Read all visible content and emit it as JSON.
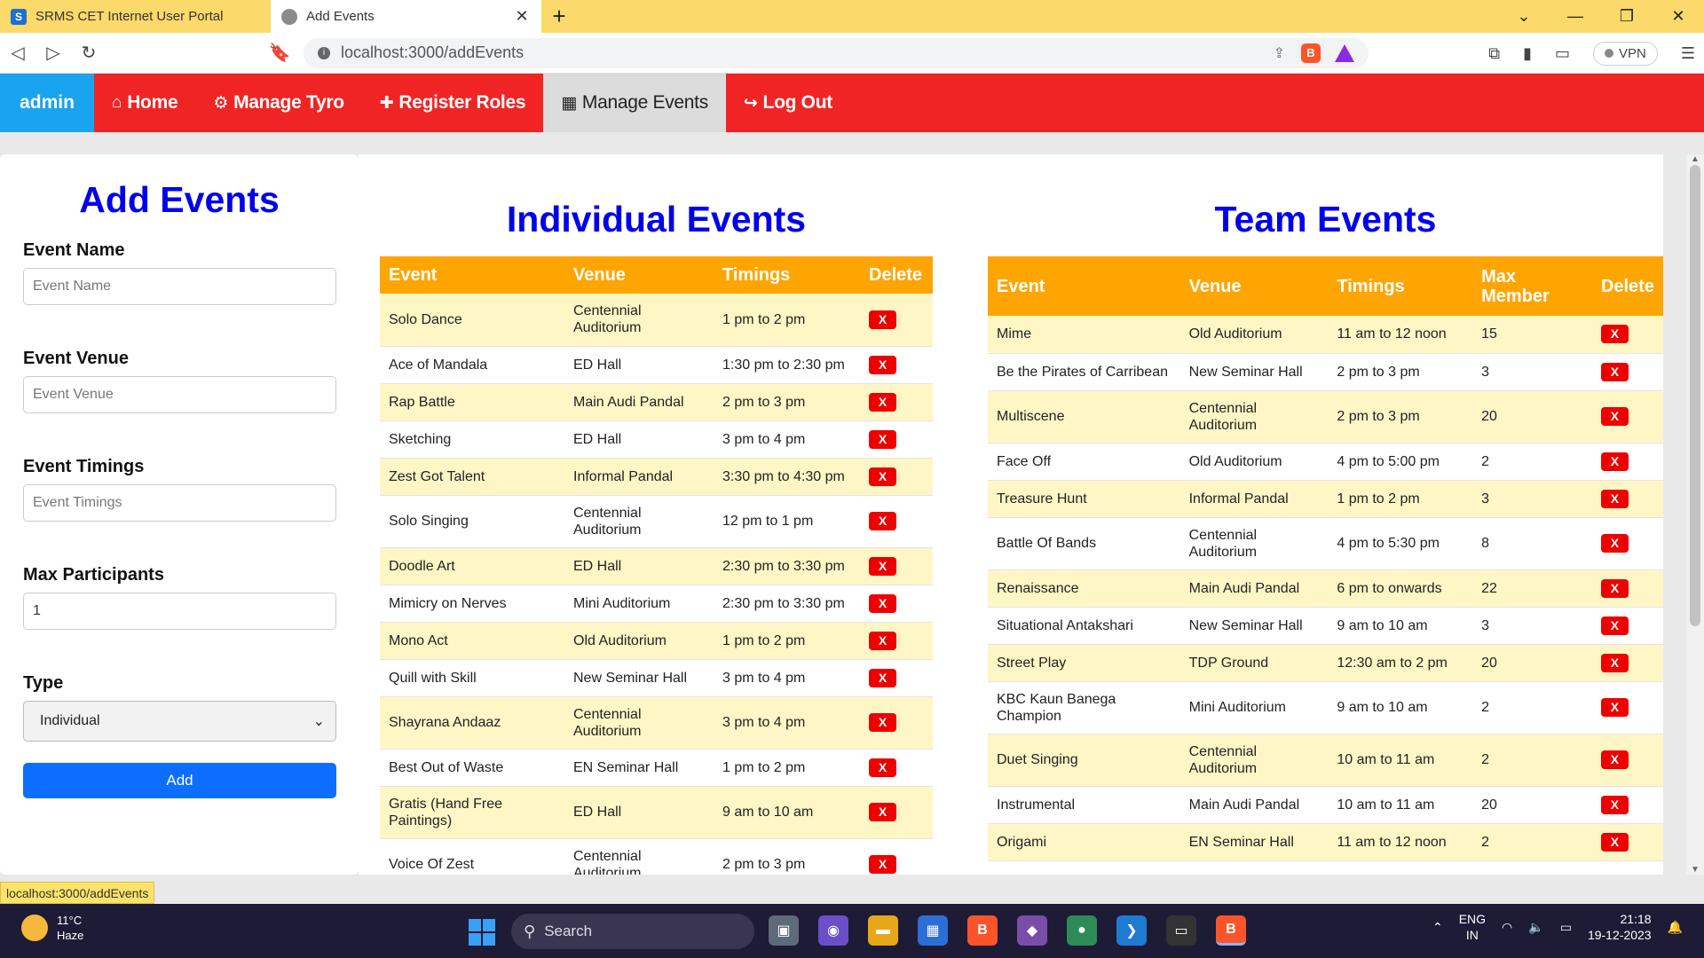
{
  "browser": {
    "tabs": [
      {
        "title": "SRMS CET Internet User Portal",
        "active": false
      },
      {
        "title": "Add Events",
        "active": true
      }
    ],
    "url": "localhost:3000/addEvents",
    "vpn_label": "VPN",
    "status_url": "localhost:3000/addEvents"
  },
  "navbar": {
    "brand": "admin",
    "items": [
      {
        "label": "Home",
        "icon": "home-icon",
        "glyph": "⌂"
      },
      {
        "label": "Manage Tyro",
        "icon": "gears-icon",
        "glyph": "⚙"
      },
      {
        "label": "Register Roles",
        "icon": "user-plus-icon",
        "glyph": "👤"
      },
      {
        "label": "Manage Events",
        "icon": "calendar-icon",
        "glyph": "📅",
        "active": true
      },
      {
        "label": "Log Out",
        "icon": "logout-icon",
        "glyph": "↪"
      }
    ],
    "colors": {
      "bar": "#f02424",
      "brand": "#1aa3ee",
      "active": "#dcdcdc"
    }
  },
  "form": {
    "title": "Add Events",
    "fields": [
      {
        "label": "Event Name",
        "placeholder": "Event Name",
        "value": ""
      },
      {
        "label": "Event Venue",
        "placeholder": "Event Venue",
        "value": ""
      },
      {
        "label": "Event Timings",
        "placeholder": "Event Timings",
        "value": ""
      },
      {
        "label": "Max Participants",
        "placeholder": "",
        "value": "1"
      }
    ],
    "type_label": "Type",
    "type_value": "Individual",
    "submit_label": "Add"
  },
  "individual": {
    "title": "Individual Events",
    "headers": [
      "Event",
      "Venue",
      "Timings",
      "Delete"
    ],
    "delete_label": "X",
    "rows": [
      [
        "Solo Dance",
        "Centennial Auditorium",
        "1 pm to 2 pm"
      ],
      [
        "Ace of Mandala",
        "ED Hall",
        "1:30 pm to 2:30 pm"
      ],
      [
        "Rap Battle",
        "Main Audi Pandal",
        "2 pm to 3 pm"
      ],
      [
        "Sketching",
        "ED Hall",
        "3 pm to 4 pm"
      ],
      [
        "Zest Got Talent",
        "Informal Pandal",
        "3:30 pm to 4:30 pm"
      ],
      [
        "Solo Singing",
        "Centennial Auditorium",
        "12 pm to 1 pm"
      ],
      [
        "Doodle Art",
        "ED Hall",
        "2:30 pm to 3:30 pm"
      ],
      [
        "Mimicry on Nerves",
        "Mini Auditorium",
        "2:30 pm to 3:30 pm"
      ],
      [
        "Mono Act",
        "Old Auditorium",
        "1 pm to 2 pm"
      ],
      [
        "Quill with Skill",
        "New Seminar Hall",
        "3 pm to 4 pm"
      ],
      [
        "Shayrana Andaaz",
        "Centennial Auditorium",
        "3 pm to 4 pm"
      ],
      [
        "Best Out of Waste",
        "EN Seminar Hall",
        "1 pm to 2 pm"
      ],
      [
        "Gratis (Hand Free Paintings)",
        "ED Hall",
        "9 am to 10 am"
      ],
      [
        "Voice Of Zest",
        "Centennial Auditorium",
        "2 pm to 3 pm"
      ]
    ]
  },
  "team": {
    "title": "Team Events",
    "headers": [
      "Event",
      "Venue",
      "Timings",
      "Max Member",
      "Delete"
    ],
    "delete_label": "X",
    "rows": [
      [
        "Mime",
        "Old Auditorium",
        "11 am to 12 noon",
        "15"
      ],
      [
        "Be the Pirates of Carribean",
        "New Seminar Hall",
        "2 pm to 3 pm",
        "3"
      ],
      [
        "Multiscene",
        "Centennial Auditorium",
        "2 pm to 3 pm",
        "20"
      ],
      [
        "Face Off",
        "Old Auditorium",
        "4 pm to 5:00 pm",
        "2"
      ],
      [
        "Treasure Hunt",
        "Informal Pandal",
        "1 pm to 2 pm",
        "3"
      ],
      [
        "Battle Of Bands",
        "Centennial Auditorium",
        "4 pm to 5:30 pm",
        "8"
      ],
      [
        "Renaissance",
        "Main Audi Pandal",
        "6 pm to onwards",
        "22"
      ],
      [
        "Situational Antakshari",
        "New Seminar Hall",
        "9 am to 10 am",
        "3"
      ],
      [
        "Street Play",
        "TDP Ground",
        "12:30 am to 2 pm",
        "20"
      ],
      [
        "KBC Kaun Banega Champion",
        "Mini Auditorium",
        "9 am to 10 am",
        "2"
      ],
      [
        "Duet Singing",
        "Centennial Auditorium",
        "10 am to 11 am",
        "2"
      ],
      [
        "Instrumental",
        "Main Audi Pandal",
        "10 am to 11 am",
        "20"
      ],
      [
        "Origami",
        "EN Seminar Hall",
        "11 am to 12 noon",
        "2"
      ]
    ]
  },
  "taskbar": {
    "temperature": "11°C",
    "weather": "Haze",
    "search_label": "Search",
    "lang_top": "ENG",
    "lang_bottom": "IN",
    "time": "21:18",
    "date": "19-12-2023"
  }
}
